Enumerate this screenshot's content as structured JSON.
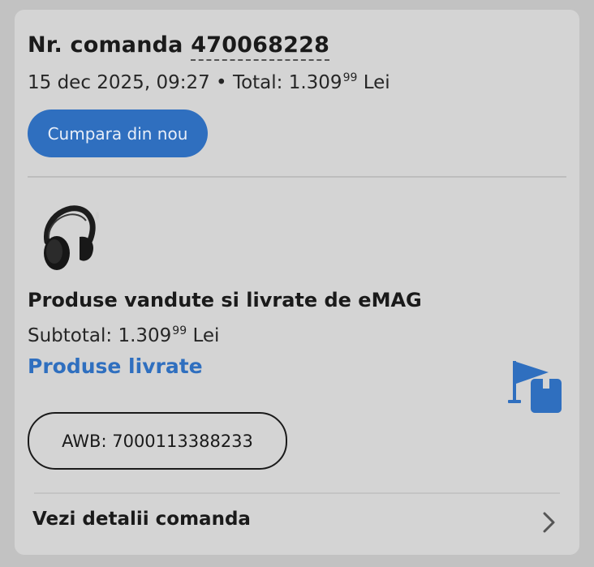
{
  "order": {
    "title_prefix": "Nr. comanda",
    "number": "470068228",
    "date": "15 dec 2025, 09:27",
    "separator": "•",
    "total_label": "Total:",
    "total_int": "1.309",
    "total_dec": "99",
    "currency": "Lei"
  },
  "actions": {
    "rebuy_label": "Cumpara din nou",
    "details_label": "Vezi detalii comanda"
  },
  "shipment": {
    "seller_text": "Produse vandute si livrate de eMAG",
    "subtotal_label": "Subtotal:",
    "subtotal_int": "1.309",
    "subtotal_dec": "99",
    "currency": "Lei",
    "status": "Produse livrate",
    "awb": "AWB: 7000113388233"
  },
  "icons": {
    "product": "headphones-product-image",
    "status": "delivered-flag-package-icon",
    "chevron": "chevron-right-icon"
  },
  "colors": {
    "accent": "#2f6fbf",
    "card_bg": "#d4d4d4",
    "page_bg": "#c2c2c2"
  }
}
